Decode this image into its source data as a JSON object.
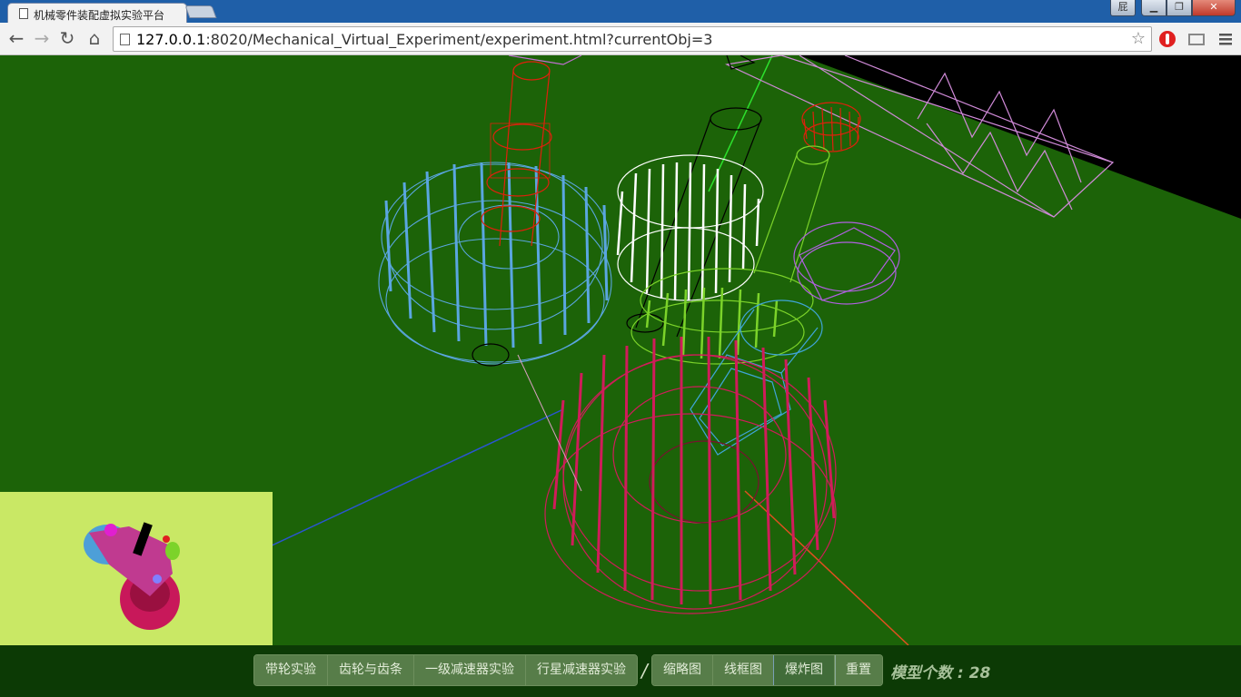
{
  "browser": {
    "tab_title": "机械零件装配虚拟实验平台",
    "url_host": "127.0.0.1",
    "url_rest": ":8020/Mechanical_Virtual_Experiment/experiment.html?currentObj=3",
    "user_badge": "屁"
  },
  "experiments": {
    "items": [
      "带轮实验",
      "齿轮与齿条",
      "一级减速器实验",
      "行星减速器实验"
    ]
  },
  "separator": "/",
  "views": {
    "items": [
      "缩略图",
      "线框图",
      "爆炸图",
      "重置"
    ],
    "active": "爆炸图"
  },
  "model_count": {
    "label": "模型个数 : 28"
  },
  "colors": {
    "scene_bg": "#1c6308",
    "minimap_bg": "#c9e865",
    "bottom_bar": "#0c3a05",
    "gear_blue": "#5aa6e0",
    "gear_pink": "#d01c5a",
    "gear_white": "#ffffff",
    "gear_green": "#7cd32a",
    "shaft_red": "#e0200c",
    "part_violet": "#b060e0"
  }
}
